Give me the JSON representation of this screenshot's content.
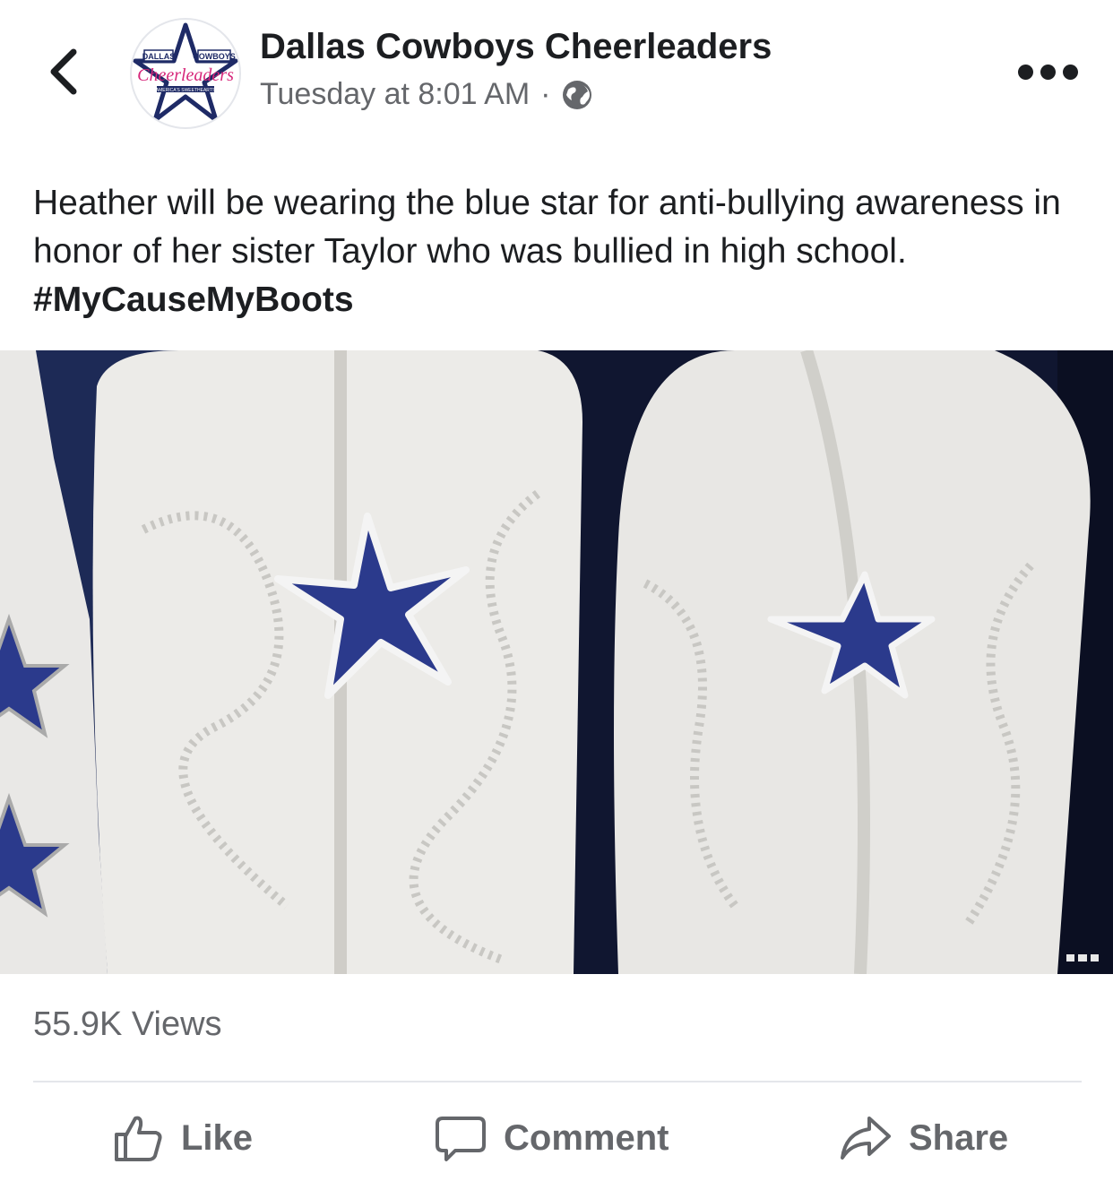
{
  "header": {
    "back_icon": "chevron-left-icon",
    "page_name": "Dallas Cowboys Cheerleaders",
    "timestamp": "Tuesday at 8:01 AM",
    "separator": "·",
    "privacy_icon": "globe-icon",
    "more_icon": "more-horizontal-icon",
    "logo": {
      "top_left": "DALLAS",
      "top_right": "COWBOYS",
      "script": "Cheerleaders",
      "tagline": "AMERICA'S SWEETHEARTS"
    }
  },
  "post": {
    "caption": "Heather will be wearing the blue star for anti-bullying awareness in honor of her sister Taylor who was bullied in high school. ",
    "hashtag": "#MyCauseMyBoots"
  },
  "video": {
    "description_icon": "video-thumbnail",
    "colors": {
      "boot": "#ecebe8",
      "star": "#2b3a8c",
      "background": "#1d2a56"
    }
  },
  "stats": {
    "views": "55.9K Views"
  },
  "actions": {
    "like": {
      "label": "Like",
      "icon": "thumbs-up-icon"
    },
    "comment": {
      "label": "Comment",
      "icon": "comment-bubble-icon"
    },
    "share": {
      "label": "Share",
      "icon": "share-arrow-icon"
    }
  }
}
